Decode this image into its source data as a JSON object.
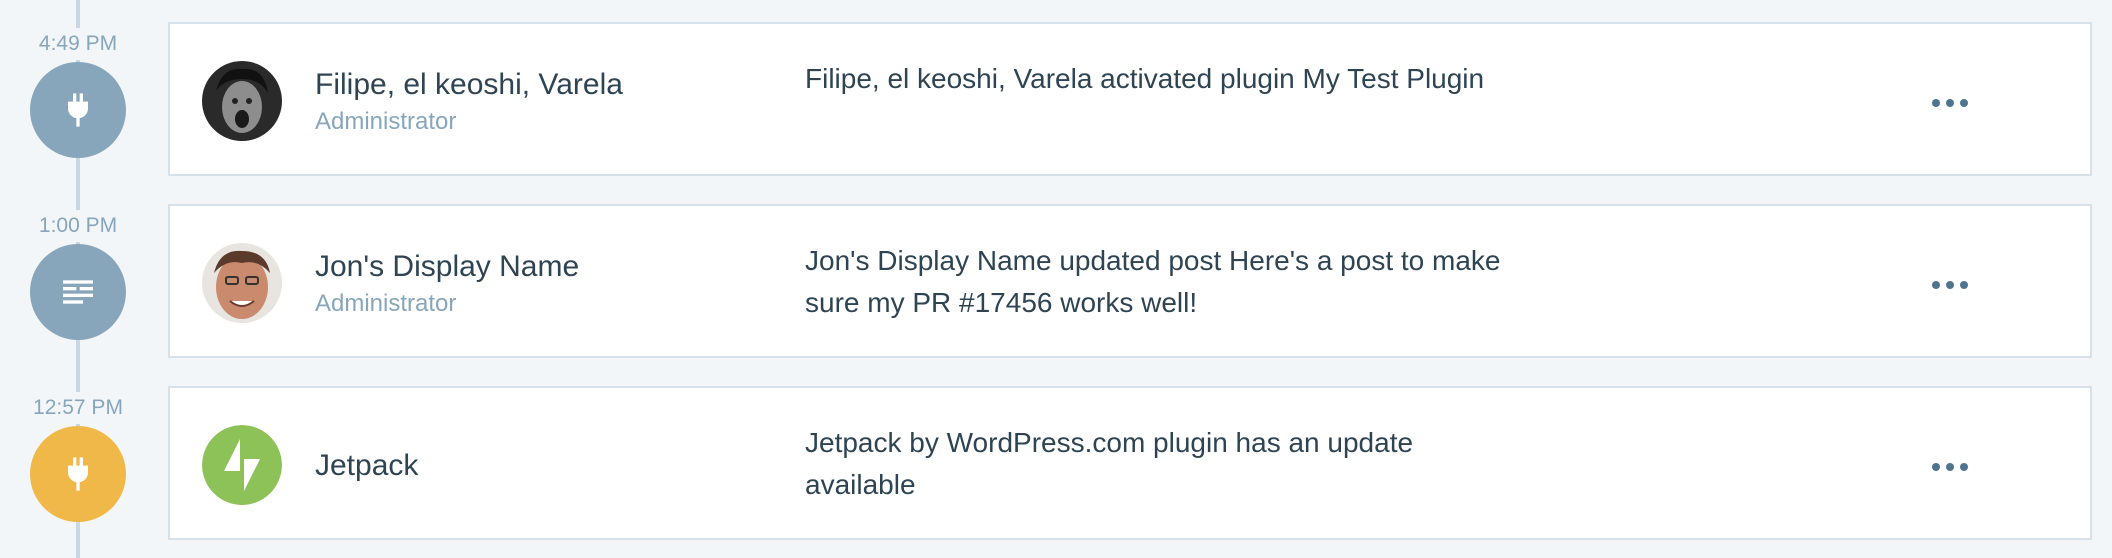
{
  "colors": {
    "plugin_circle": "#87a6bc",
    "post_circle": "#87a6bc",
    "jetpack_alert_circle": "#f0b849",
    "jetpack_green": "#8cc258"
  },
  "entries": [
    {
      "time": "4:49 PM",
      "icon": "plug-icon",
      "actor_name": "Filipe, el keoshi, Varela",
      "actor_role": "Administrator",
      "description": "Filipe, el keoshi, Varela activated plugin My Test Plugin",
      "more_label": "•••"
    },
    {
      "time": "1:00 PM",
      "icon": "posts-icon",
      "actor_name": "Jon's Display Name",
      "actor_role": "Administrator",
      "description": "Jon's Display Name updated post Here's a post to make sure my PR #17456 works well!",
      "more_label": "•••"
    },
    {
      "time": "12:57 PM",
      "icon": "plug-icon",
      "actor_name": "Jetpack",
      "actor_role": "",
      "description": "Jetpack by WordPress.com plugin has an update available",
      "more_label": "•••"
    }
  ]
}
